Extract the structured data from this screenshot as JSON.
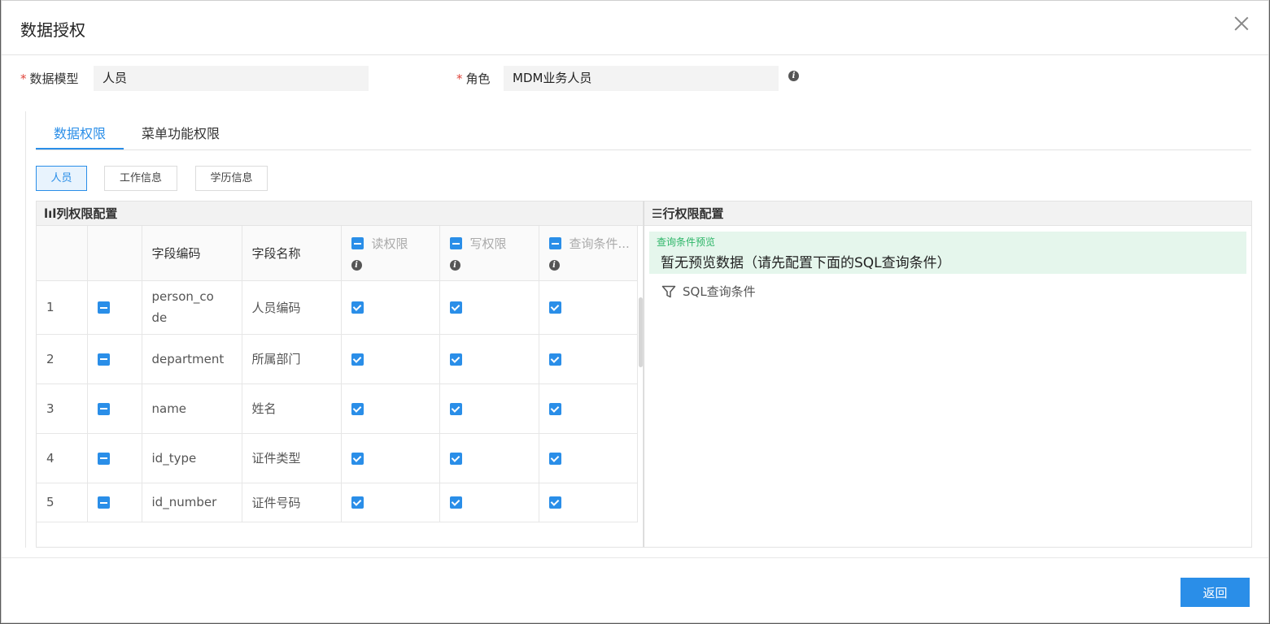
{
  "dialog": {
    "title": "数据授权"
  },
  "form": {
    "model_label": "数据模型",
    "model_value": "人员",
    "role_label": "角色",
    "role_value": "MDM业务人员",
    "required_mark": "*",
    "info_glyph": "i"
  },
  "tabs": [
    {
      "label": "数据权限",
      "active": true
    },
    {
      "label": "菜单功能权限",
      "active": false
    }
  ],
  "sub_tabs": [
    {
      "label": "人员",
      "active": true
    },
    {
      "label": "工作信息",
      "active": false
    },
    {
      "label": "学历信息",
      "active": false
    }
  ],
  "column_panel": {
    "title": "lıl列权限配置",
    "headers": {
      "code": "字段编码",
      "name": "字段名称",
      "read": "读权限",
      "write": "写权限",
      "query": "查询条件..."
    },
    "rows": [
      {
        "index": "1",
        "code": "person_code",
        "name": "人员编码"
      },
      {
        "index": "2",
        "code": "department",
        "name": "所属部门"
      },
      {
        "index": "3",
        "code": "name",
        "name": "姓名"
      },
      {
        "index": "4",
        "code": "id_type",
        "name": "证件类型"
      },
      {
        "index": "5",
        "code": "id_number",
        "name": "证件号码"
      }
    ]
  },
  "row_panel": {
    "title": "☰行权限配置",
    "preview_label": "查询条件预览",
    "preview_text": "暂无预览数据（请先配置下面的SQL查询条件）",
    "sql_label": "SQL查询条件"
  },
  "footer": {
    "back_label": "返回"
  },
  "colors": {
    "accent": "#2a8ee8",
    "preview_bg": "#e5f6ec",
    "preview_label": "#2cb567",
    "required": "#e0443b"
  }
}
